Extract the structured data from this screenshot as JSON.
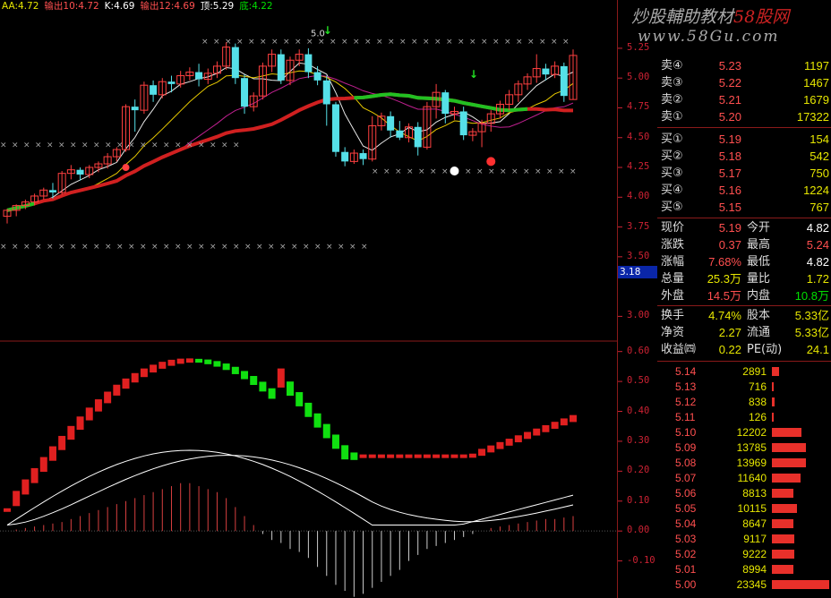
{
  "header": [
    {
      "label": "AA:4.72",
      "color": "#e6e600"
    },
    {
      "label": "输出10:4.72",
      "color": "#ff5050"
    },
    {
      "label": "K:4.69",
      "color": "#ffffff"
    },
    {
      "label": "输出12:4.69",
      "color": "#ff5050"
    },
    {
      "label": "顶:5.29",
      "color": "#ffffff"
    },
    {
      "label": "底:4.22",
      "color": "#00e000"
    }
  ],
  "watermark": {
    "line1a": "炒股輔助教材",
    "line1b": "58股网",
    "line2": "www.58Gu.com"
  },
  "price_axis": [
    "5.25",
    "5.00",
    "4.75",
    "4.50",
    "4.25",
    "4.00",
    "3.75",
    "3.50",
    "3.00"
  ],
  "indicator_axis": [
    "0.60",
    "0.50",
    "0.40",
    "0.30",
    "0.20",
    "0.10",
    "0.00",
    "-0.10"
  ],
  "price_tag": "3.18",
  "annotation_top": "5.0",
  "sell": [
    {
      "label": "卖④",
      "price": "5.23",
      "vol": "1197"
    },
    {
      "label": "卖③",
      "price": "5.22",
      "vol": "1467"
    },
    {
      "label": "卖②",
      "price": "5.21",
      "vol": "1679"
    },
    {
      "label": "卖①",
      "price": "5.20",
      "vol": "17322"
    }
  ],
  "buy": [
    {
      "label": "买①",
      "price": "5.19",
      "vol": "154"
    },
    {
      "label": "买②",
      "price": "5.18",
      "vol": "542"
    },
    {
      "label": "买③",
      "price": "5.17",
      "vol": "750"
    },
    {
      "label": "买④",
      "price": "5.16",
      "vol": "1224"
    },
    {
      "label": "买⑤",
      "price": "5.15",
      "vol": "767"
    }
  ],
  "stats": [
    {
      "l1": "现价",
      "v1": "5.19",
      "c1": "#ff4f4f",
      "l2": "今开",
      "v2": "4.82",
      "c2": "#ffffff"
    },
    {
      "l1": "涨跌",
      "v1": "0.37",
      "c1": "#ff4f4f",
      "l2": "最高",
      "v2": "5.24",
      "c2": "#ff4f4f"
    },
    {
      "l1": "涨幅",
      "v1": "7.68%",
      "c1": "#ff4f4f",
      "l2": "最低",
      "v2": "4.82",
      "c2": "#ffffff"
    },
    {
      "l1": "总量",
      "v1": "25.3万",
      "c1": "#e6e600",
      "l2": "量比",
      "v2": "1.72",
      "c2": "#e6e600"
    },
    {
      "l1": "外盘",
      "v1": "14.5万",
      "c1": "#ff4f4f",
      "l2": "内盘",
      "v2": "10.8万",
      "c2": "#00e000"
    },
    {
      "l1": "换手",
      "v1": "4.74%",
      "c1": "#e6e600",
      "l2": "股本",
      "v2": "5.33亿",
      "c2": "#e6e600"
    },
    {
      "l1": "净资",
      "v1": "2.27",
      "c1": "#e6e600",
      "l2": "流通",
      "v2": "5.33亿",
      "c2": "#e6e600"
    },
    {
      "l1": "收益㈣",
      "v1": "0.22",
      "c1": "#e6e600",
      "l2": "PE(动)",
      "v2": "24.1",
      "c2": "#e6e600"
    }
  ],
  "depth": [
    {
      "price": "5.14",
      "vol": "2891",
      "bar": 0.12
    },
    {
      "price": "5.13",
      "vol": "716",
      "bar": 0.03
    },
    {
      "price": "5.12",
      "vol": "838",
      "bar": 0.04
    },
    {
      "price": "5.11",
      "vol": "126",
      "bar": 0.01
    },
    {
      "price": "5.10",
      "vol": "12202",
      "bar": 0.52
    },
    {
      "price": "5.09",
      "vol": "13785",
      "bar": 0.59
    },
    {
      "price": "5.08",
      "vol": "13969",
      "bar": 0.6
    },
    {
      "price": "5.07",
      "vol": "11640",
      "bar": 0.5
    },
    {
      "price": "5.06",
      "vol": "8813",
      "bar": 0.38
    },
    {
      "price": "5.05",
      "vol": "10115",
      "bar": 0.43
    },
    {
      "price": "5.04",
      "vol": "8647",
      "bar": 0.37
    },
    {
      "price": "5.03",
      "vol": "9117",
      "bar": 0.39
    },
    {
      "price": "5.02",
      "vol": "9222",
      "bar": 0.39
    },
    {
      "price": "5.01",
      "vol": "8994",
      "bar": 0.38
    },
    {
      "price": "5.00",
      "vol": "23345",
      "bar": 1.0
    }
  ],
  "chart_data": {
    "type": "candlestick",
    "price_range": [
      2.8,
      5.55
    ],
    "candles": [
      [
        3.84,
        3.89,
        3.78,
        3.9
      ],
      [
        3.89,
        3.93,
        3.84,
        3.94
      ],
      [
        3.93,
        3.96,
        3.9,
        3.98
      ],
      [
        3.96,
        4.01,
        3.93,
        4.03
      ],
      [
        4.01,
        4.06,
        3.98,
        4.08
      ],
      [
        4.06,
        4.04,
        3.99,
        4.12
      ],
      [
        4.04,
        4.2,
        4.02,
        4.22
      ],
      [
        4.2,
        4.23,
        4.15,
        4.27
      ],
      [
        4.23,
        4.19,
        4.14,
        4.25
      ],
      [
        4.19,
        4.25,
        4.16,
        4.27
      ],
      [
        4.25,
        4.28,
        4.21,
        4.3
      ],
      [
        4.28,
        4.34,
        4.24,
        4.37
      ],
      [
        4.34,
        4.4,
        4.3,
        4.42
      ],
      [
        4.4,
        4.76,
        4.38,
        4.78
      ],
      [
        4.76,
        4.73,
        4.55,
        4.82
      ],
      [
        4.73,
        4.94,
        4.7,
        4.97
      ],
      [
        4.94,
        4.86,
        4.8,
        4.98
      ],
      [
        4.86,
        4.97,
        4.83,
        5.0
      ],
      [
        4.97,
        4.95,
        4.88,
        5.02
      ],
      [
        4.95,
        5.02,
        4.92,
        5.06
      ],
      [
        5.02,
        5.05,
        4.98,
        5.09
      ],
      [
        5.05,
        4.99,
        4.93,
        5.12
      ],
      [
        4.99,
        5.04,
        4.95,
        5.08
      ],
      [
        5.04,
        5.1,
        5.0,
        5.14
      ],
      [
        5.1,
        5.26,
        5.07,
        5.3
      ],
      [
        5.26,
        5.0,
        4.95,
        5.29
      ],
      [
        5.0,
        4.76,
        4.7,
        5.03
      ],
      [
        4.76,
        4.85,
        4.72,
        4.88
      ],
      [
        4.85,
        5.1,
        4.82,
        5.13
      ],
      [
        5.1,
        5.2,
        5.05,
        5.24
      ],
      [
        5.2,
        4.98,
        4.95,
        5.24
      ],
      [
        4.98,
        5.15,
        4.94,
        5.18
      ],
      [
        5.15,
        5.2,
        5.1,
        5.24
      ],
      [
        5.2,
        5.05,
        5.0,
        5.25
      ],
      [
        5.05,
        4.98,
        4.94,
        5.1
      ],
      [
        4.98,
        4.78,
        4.6,
        5.02
      ],
      [
        4.78,
        4.38,
        4.34,
        4.8
      ],
      [
        4.38,
        4.3,
        4.26,
        4.42
      ],
      [
        4.3,
        4.37,
        4.28,
        4.4
      ],
      [
        4.37,
        4.32,
        4.27,
        4.4
      ],
      [
        4.32,
        4.6,
        4.3,
        4.68
      ],
      [
        4.6,
        4.68,
        4.56,
        4.71
      ],
      [
        4.68,
        4.56,
        4.5,
        4.72
      ],
      [
        4.56,
        4.5,
        4.48,
        4.64
      ],
      [
        4.5,
        4.59,
        4.46,
        4.62
      ],
      [
        4.59,
        4.42,
        4.35,
        4.63
      ],
      [
        4.42,
        4.76,
        4.4,
        4.8
      ],
      [
        4.76,
        4.88,
        4.66,
        4.95
      ],
      [
        4.88,
        4.7,
        4.62,
        4.9
      ],
      [
        4.7,
        4.72,
        4.65,
        4.76
      ],
      [
        4.72,
        4.52,
        4.48,
        4.76
      ],
      [
        4.52,
        4.55,
        4.47,
        4.58
      ],
      [
        4.55,
        4.62,
        4.42,
        4.65
      ],
      [
        4.62,
        4.7,
        4.55,
        4.73
      ],
      [
        4.7,
        4.78,
        4.66,
        4.81
      ],
      [
        4.78,
        4.86,
        4.73,
        4.9
      ],
      [
        4.86,
        4.95,
        4.8,
        4.98
      ],
      [
        4.95,
        5.01,
        4.9,
        5.04
      ],
      [
        5.01,
        5.08,
        4.96,
        5.2
      ],
      [
        5.08,
        5.03,
        4.98,
        5.12
      ],
      [
        5.03,
        5.1,
        5.0,
        5.14
      ],
      [
        5.1,
        4.85,
        4.8,
        5.13
      ],
      [
        4.82,
        5.19,
        4.82,
        5.24
      ]
    ],
    "macd_bars": [
      0.0,
      0.005,
      0.01,
      0.015,
      0.02,
      0.025,
      0.03,
      0.04,
      0.05,
      0.06,
      0.07,
      0.08,
      0.09,
      0.1,
      0.11,
      0.12,
      0.13,
      0.14,
      0.15,
      0.16,
      0.16,
      0.15,
      0.14,
      0.13,
      0.11,
      0.08,
      0.05,
      0.02,
      -0.01,
      -0.03,
      -0.04,
      -0.06,
      -0.07,
      -0.09,
      -0.12,
      -0.15,
      -0.18,
      -0.2,
      -0.22,
      -0.21,
      -0.19,
      -0.17,
      -0.15,
      -0.13,
      -0.1,
      -0.08,
      -0.06,
      -0.05,
      -0.04,
      -0.03,
      -0.02,
      -0.01,
      0.0,
      0.01,
      0.015,
      0.02,
      0.025,
      0.03,
      0.035,
      0.04,
      0.04,
      0.045,
      0.05
    ],
    "markers": {
      "cross_upper": 5.31,
      "cross_left": 4.44,
      "cross_low": 3.59,
      "cross_mid": 4.22
    }
  }
}
